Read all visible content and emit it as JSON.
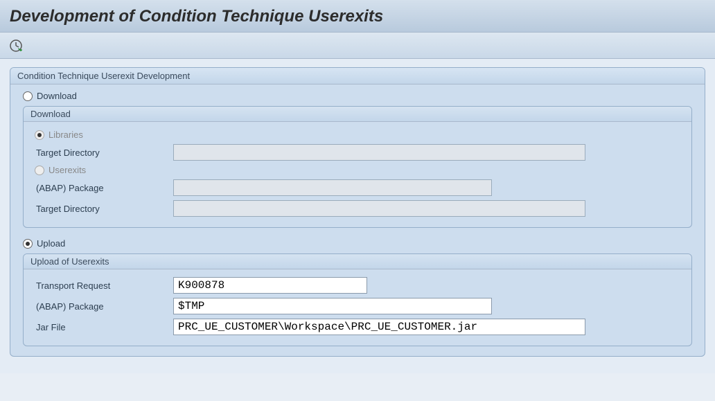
{
  "title": "Development of Condition Technique Userexits",
  "main_group": {
    "header": "Condition Technique Userexit Development",
    "download": {
      "radio_label": "Download",
      "group_header": "Download",
      "libraries": {
        "radio_label": "Libraries",
        "target_dir_label": "Target Directory",
        "target_dir_value": ""
      },
      "userexits": {
        "radio_label": "Userexits",
        "package_label": "(ABAP) Package",
        "package_value": "",
        "target_dir_label": "Target Directory",
        "target_dir_value": ""
      }
    },
    "upload": {
      "radio_label": "Upload",
      "group_header": "Upload of Userexits",
      "transport_label": "Transport Request",
      "transport_value": "K900878",
      "package_label": "(ABAP) Package",
      "package_value": "$TMP",
      "jar_label": "Jar File",
      "jar_value": "PRC_UE_CUSTOMER\\Workspace\\PRC_UE_CUSTOMER.jar"
    }
  }
}
